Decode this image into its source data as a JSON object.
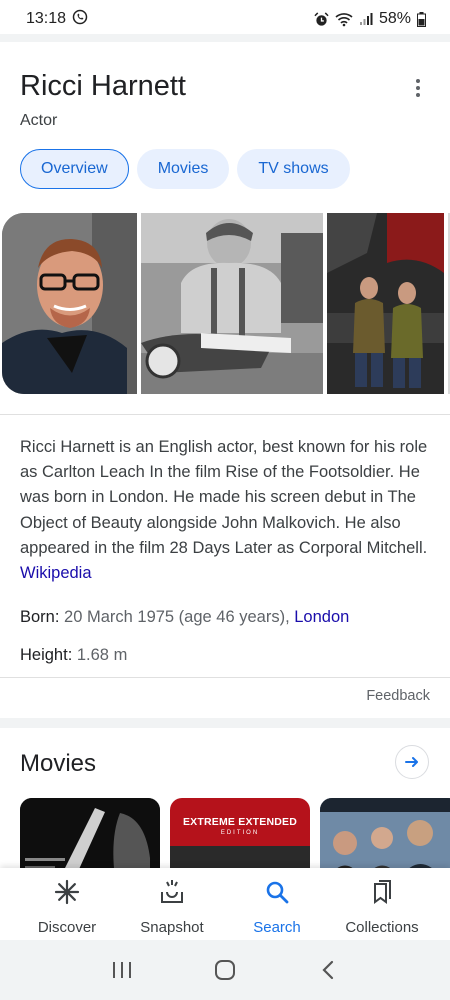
{
  "status_bar": {
    "time": "13:18",
    "battery": "58%",
    "icons": [
      "whatsapp-icon",
      "alarm-icon",
      "wifi-icon",
      "signal-icon",
      "battery-icon"
    ]
  },
  "entity": {
    "name": "Ricci Harnett",
    "type": "Actor"
  },
  "tabs": [
    {
      "label": "Overview",
      "active": true
    },
    {
      "label": "Movies",
      "active": false
    },
    {
      "label": "TV shows",
      "active": false
    }
  ],
  "description": {
    "text": "Ricci Harnett is an English actor, best known for his role as Carlton Leach In the film Rise of the Footsoldier. He was born in London. He made his screen debut in The Object of Beauty alongside John Malkovich. He also appeared in the film 28 Days Later as Corporal Mitchell.",
    "source_link": "Wikipedia"
  },
  "facts": {
    "born_label": "Born",
    "born_value": "20 March 1975 (age 46 years), ",
    "born_link": "London",
    "height_label": "Height",
    "height_value": "1.68 m"
  },
  "feedback_label": "Feedback",
  "movies_section": {
    "title": "Movies",
    "poster2_title": "EXTREME EXTENDED",
    "poster2_sub": "EDITION"
  },
  "bottom_nav": [
    {
      "label": "Discover",
      "icon": "discover-icon",
      "active": false
    },
    {
      "label": "Snapshot",
      "icon": "snapshot-icon",
      "active": false
    },
    {
      "label": "Search",
      "icon": "search-icon",
      "active": true
    },
    {
      "label": "Collections",
      "icon": "collections-icon",
      "active": false
    }
  ],
  "colors": {
    "accent": "#1a73e8",
    "link": "#1a0dab",
    "chip_bg": "#e8f0fe"
  }
}
